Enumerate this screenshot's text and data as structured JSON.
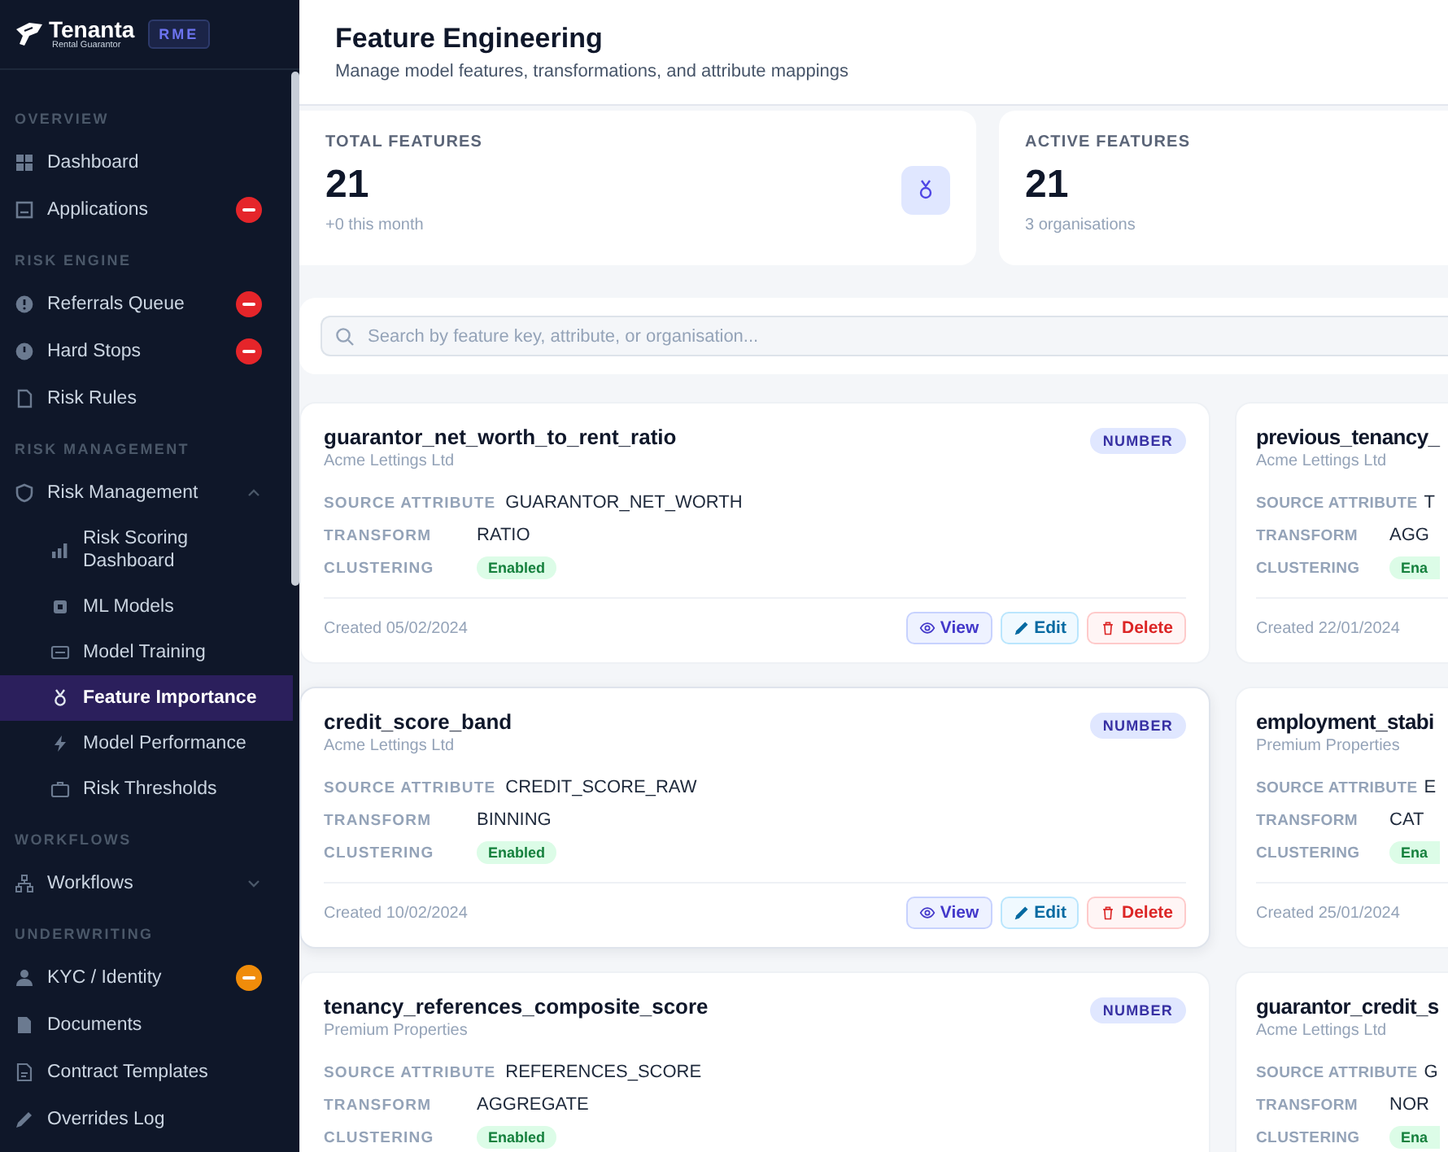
{
  "brand": {
    "name": "Tenanta",
    "tagline": "Rental Guarantor",
    "badge": "RME"
  },
  "sidebar": {
    "sections": [
      {
        "label": "OVERVIEW",
        "items": [
          {
            "label": "Dashboard",
            "selected": false
          },
          {
            "label": "Applications",
            "selected": false,
            "color": "#e5252a"
          }
        ]
      },
      {
        "label": "RISK ENGINE",
        "items": [
          {
            "label": "Referrals Queue",
            "selected": false,
            "color": "#e5252a"
          },
          {
            "label": "Hard Stops",
            "selected": false,
            "color": "#e5252a"
          },
          {
            "label": "Risk Rules",
            "selected": false
          }
        ]
      },
      {
        "label": "RISK MANAGEMENT",
        "items": [
          {
            "label": "Risk Management",
            "selected": false,
            "expanded": true,
            "children": [
              {
                "label": "Risk Scoring Dashboard",
                "selected": false
              },
              {
                "label": "ML Models",
                "selected": false
              },
              {
                "label": "Model Training",
                "selected": false
              },
              {
                "label": "Feature Importance",
                "selected": true
              },
              {
                "label": "Model Performance",
                "selected": false
              },
              {
                "label": "Risk Thresholds",
                "selected": false
              }
            ]
          }
        ]
      },
      {
        "label": "WORKFLOWS",
        "items": [
          {
            "label": "Workflows",
            "selected": false,
            "expanded": false
          }
        ]
      },
      {
        "label": "UNDERWRITING",
        "items": [
          {
            "label": "KYC / Identity",
            "selected": false,
            "color": "#f08c0a"
          },
          {
            "label": "Documents",
            "selected": false
          },
          {
            "label": "Contract Templates",
            "selected": false
          },
          {
            "label": "Overrides Log",
            "selected": false
          }
        ]
      }
    ]
  },
  "header": {
    "title": "Feature Engineering",
    "subtitle": "Manage model features, transformations, and attribute mappings"
  },
  "stats": [
    {
      "label": "TOTAL FEATURES",
      "value": "21",
      "note": "+0 this month"
    },
    {
      "label": "ACTIVE FEATURES",
      "value": "21",
      "note": "3 organisations"
    }
  ],
  "search": {
    "placeholder": "Search by feature key, attribute, or organisation..."
  },
  "cards": [
    {
      "title": "guarantor_net_worth_to_rent_ratio",
      "org": "Acme Lettings Ltd",
      "type": "NUMBER",
      "hovered": false,
      "fields": [
        {
          "label": "SOURCE ATTRIBUTE",
          "value": "GUARANTOR_NET_WORTH",
          "kind": "text"
        },
        {
          "label": "TRANSFORM",
          "value": "RATIO",
          "kind": "text"
        },
        {
          "label": "CLUSTERING",
          "value": "Enabled",
          "kind": "badge"
        }
      ],
      "created": "Created 05/02/2024",
      "actions": [
        {
          "label": "View",
          "kind": "view"
        },
        {
          "label": "Edit",
          "kind": "edit"
        },
        {
          "label": "Delete",
          "kind": "delete"
        }
      ]
    },
    {
      "title": "previous_tenancy_",
      "org": "Acme Lettings Ltd",
      "hovered": false,
      "fields": [
        {
          "label": "SOURCE ATTRIBUTE",
          "value": "T",
          "kind": "text"
        },
        {
          "label": "TRANSFORM",
          "value": "AGG",
          "kind": "text"
        },
        {
          "label": "CLUSTERING",
          "value": "Ena",
          "kind": "badge"
        }
      ],
      "created": "Created 22/01/2024"
    },
    {
      "title": "credit_score_band",
      "org": "Acme Lettings Ltd",
      "type": "NUMBER",
      "hovered": true,
      "fields": [
        {
          "label": "SOURCE ATTRIBUTE",
          "value": "CREDIT_SCORE_RAW",
          "kind": "text"
        },
        {
          "label": "TRANSFORM",
          "value": "BINNING",
          "kind": "text"
        },
        {
          "label": "CLUSTERING",
          "value": "Enabled",
          "kind": "badge"
        }
      ],
      "created": "Created 10/02/2024",
      "actions": [
        {
          "label": "View",
          "kind": "view"
        },
        {
          "label": "Edit",
          "kind": "edit"
        },
        {
          "label": "Delete",
          "kind": "delete"
        }
      ]
    },
    {
      "title": "employment_stabi",
      "org": "Premium Properties",
      "hovered": false,
      "fields": [
        {
          "label": "SOURCE ATTRIBUTE",
          "value": "E",
          "kind": "text"
        },
        {
          "label": "TRANSFORM",
          "value": "CAT",
          "kind": "text"
        },
        {
          "label": "CLUSTERING",
          "value": "Ena",
          "kind": "badge"
        }
      ],
      "created": "Created 25/01/2024"
    },
    {
      "title": "tenancy_references_composite_score",
      "org": "Premium Properties",
      "type": "NUMBER",
      "hovered": false,
      "fields": [
        {
          "label": "SOURCE ATTRIBUTE",
          "value": "REFERENCES_SCORE",
          "kind": "text"
        },
        {
          "label": "TRANSFORM",
          "value": "AGGREGATE",
          "kind": "text"
        },
        {
          "label": "CLUSTERING",
          "value": "Enabled",
          "kind": "badge"
        }
      ]
    },
    {
      "title": "guarantor_credit_s",
      "org": "Acme Lettings Ltd",
      "hovered": false,
      "fields": [
        {
          "label": "SOURCE ATTRIBUTE",
          "value": "G",
          "kind": "text"
        },
        {
          "label": "TRANSFORM",
          "value": "NOR",
          "kind": "text"
        },
        {
          "label": "CLUSTERING",
          "value": "Ena",
          "kind": "badge"
        }
      ]
    }
  ]
}
